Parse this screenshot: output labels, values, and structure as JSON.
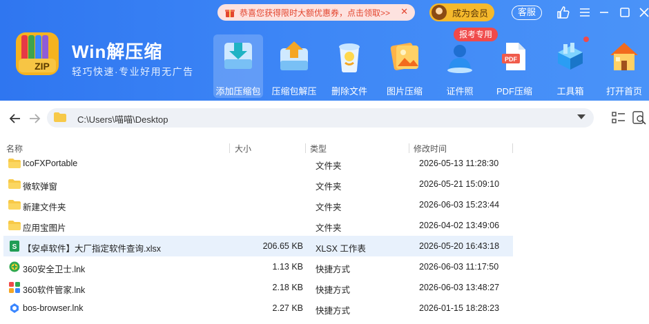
{
  "app": {
    "title": "Win解压缩",
    "subtitle": "轻巧快速·专业好用无广告",
    "logo_text": "ZIP"
  },
  "promo": {
    "text": "恭喜您获得限时大额优惠券，点击领取>>",
    "close": "✕"
  },
  "member": {
    "label": "成为会员"
  },
  "service": {
    "label": "客服"
  },
  "toolbar": {
    "badge": "报考专用",
    "items": [
      {
        "label": "添加压缩包",
        "icon": "add-archive-icon"
      },
      {
        "label": "压缩包解压",
        "icon": "extract-archive-icon"
      },
      {
        "label": "删除文件",
        "icon": "trash-icon"
      },
      {
        "label": "图片压缩",
        "icon": "image-compress-icon"
      },
      {
        "label": "证件照",
        "icon": "id-photo-icon"
      },
      {
        "label": "PDF压缩",
        "icon": "pdf-icon"
      },
      {
        "label": "工具箱",
        "icon": "toolbox-icon"
      },
      {
        "label": "打开首页",
        "icon": "home-icon"
      }
    ]
  },
  "address": {
    "path": "C:\\Users\\喵喵\\Desktop"
  },
  "columns": {
    "name": "名称",
    "size": "大小",
    "type": "类型",
    "modified": "修改时间"
  },
  "files": [
    {
      "name": "IcoFXPortable",
      "size": "",
      "type": "文件夹",
      "modified": "2026-05-13 11:28:30",
      "icon": "folder-icon"
    },
    {
      "name": "微软弹窗",
      "size": "",
      "type": "文件夹",
      "modified": "2026-05-21 15:09:10",
      "icon": "folder-icon"
    },
    {
      "name": "新建文件夹",
      "size": "",
      "type": "文件夹",
      "modified": "2026-06-03 15:23:44",
      "icon": "folder-icon"
    },
    {
      "name": "应用宝图片",
      "size": "",
      "type": "文件夹",
      "modified": "2026-04-02 13:49:06",
      "icon": "folder-icon"
    },
    {
      "name": "【安卓软件】大厂指定软件查询.xlsx",
      "size": "206.65 KB",
      "type": "XLSX 工作表",
      "modified": "2026-05-20 16:43:18",
      "icon": "excel-icon"
    },
    {
      "name": "360安全卫士.lnk",
      "size": "1.13 KB",
      "type": "快捷方式",
      "modified": "2026-06-03 11:17:50",
      "icon": "360-security-icon"
    },
    {
      "name": "360软件管家.lnk",
      "size": "2.18 KB",
      "type": "快捷方式",
      "modified": "2026-06-03 13:48:27",
      "icon": "360-software-icon"
    },
    {
      "name": "bos-browser.lnk",
      "size": "2.27 KB",
      "type": "快捷方式",
      "modified": "2026-01-15 18:28:23",
      "icon": "browser-icon"
    }
  ],
  "colors": {
    "header": "#3d86f6",
    "accent": "#f04a4a",
    "selected_row": "#e8f1fc"
  }
}
